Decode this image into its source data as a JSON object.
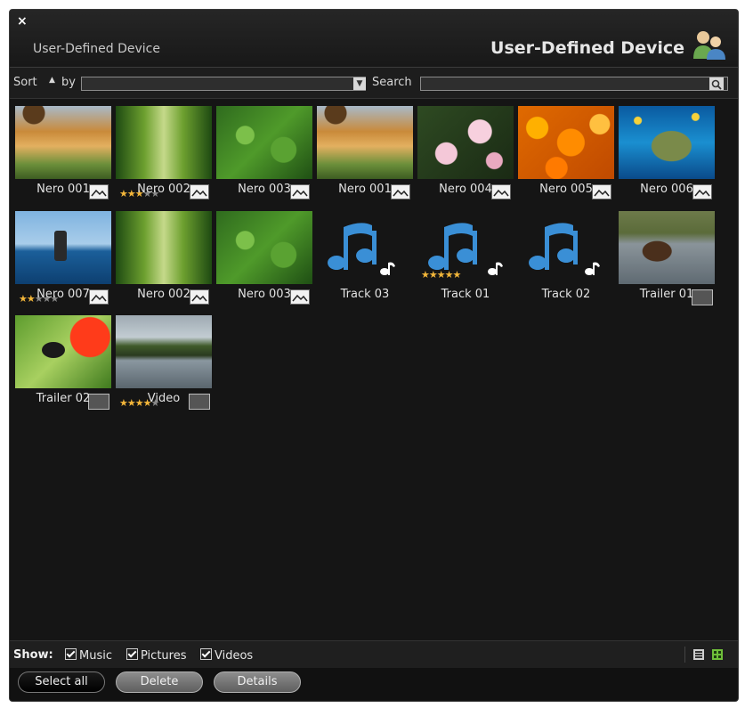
{
  "window": {
    "close_label": "×",
    "subtitle": "User-Defined Device",
    "title": "User-Defined Device"
  },
  "toolbar": {
    "sort_label": "Sort",
    "sort_arrow": "▲",
    "by_label": "by",
    "sort_value": "",
    "search_label": "Search",
    "search_value": ""
  },
  "items": [
    {
      "caption": "Nero 001",
      "type": "picture",
      "rating": 0
    },
    {
      "caption": "Nero 002",
      "type": "picture",
      "rating": 3
    },
    {
      "caption": "Nero 003",
      "type": "picture",
      "rating": 0
    },
    {
      "caption": "Nero 001",
      "type": "picture",
      "rating": 0
    },
    {
      "caption": "Nero 004",
      "type": "picture",
      "rating": 0
    },
    {
      "caption": "Nero 005",
      "type": "picture",
      "rating": 0
    },
    {
      "caption": "Nero 006",
      "type": "picture",
      "rating": 0
    },
    {
      "caption": "Nero 007",
      "type": "picture",
      "rating": 2
    },
    {
      "caption": "Nero 002",
      "type": "picture",
      "rating": 0
    },
    {
      "caption": "Nero 003",
      "type": "picture",
      "rating": 0
    },
    {
      "caption": "Track 03",
      "type": "music",
      "rating": 0
    },
    {
      "caption": "Track 01",
      "type": "music",
      "rating": 5
    },
    {
      "caption": "Track 02",
      "type": "music",
      "rating": 0
    },
    {
      "caption": "Trailer 01",
      "type": "video",
      "rating": 0
    },
    {
      "caption": "Trailer 02",
      "type": "video",
      "rating": 0
    },
    {
      "caption": "Video",
      "type": "video",
      "rating": 4
    }
  ],
  "filters": {
    "show_label": "Show:",
    "music_label": "Music",
    "pictures_label": "Pictures",
    "videos_label": "Videos"
  },
  "buttons": {
    "select_all": "Select all",
    "delete": "Delete",
    "details": "Details"
  },
  "colors": {
    "background": "#151515",
    "accent_star": "#f3b63a",
    "music_note": "#3a8fd6"
  }
}
